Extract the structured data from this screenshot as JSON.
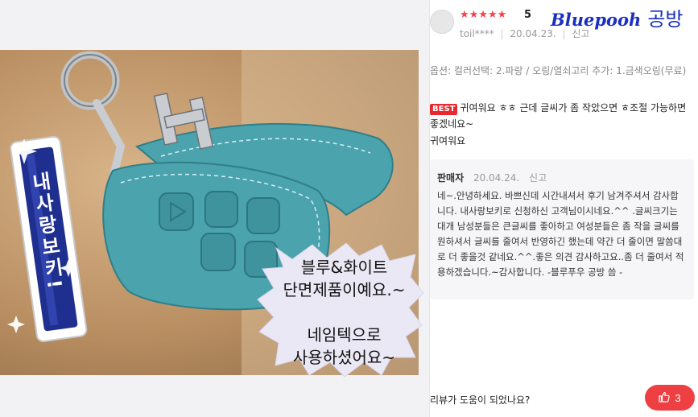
{
  "review": {
    "stars": "★★★★★",
    "rating": "5",
    "user": "toil****",
    "date": "20.04.23.",
    "report": "신고",
    "brand_en": "Bluepooh",
    "brand_kr": "공방",
    "option": "옵션: 컬러선택: 2.파랑 / 오링/열쇠고리 추가: 1.금색오링(무료)",
    "best_badge": "BEST",
    "text": "귀여워요 ㅎㅎ 근데 글씨가 좀 작았으면 ㅎ조절 가능하면 좋겠네요~",
    "text2": "귀여워요"
  },
  "photo": {
    "tag_text": "내사랑보키!",
    "bubble_line1": "블루&화이트",
    "bubble_line2": "단면제품이예요.~",
    "bubble_line3": "네임텍으로",
    "bubble_line4": "사용하셨어요~"
  },
  "reply": {
    "author": "판매자",
    "date": "20.04.24.",
    "report": "신고",
    "body": "네~.안녕하세요. 바쁘신데 시간내셔서 후기 남겨주셔서 감사합니다. 내사랑보키로 신청하신 고객님이시네요.^^ .글씨크기는 대개 남성분들은 큰글씨를 좋아하고 여성분들은 좀 작을 글씨를 원하셔서 글씨를 줄여서 반영하긴 했는데 약간 더 줄이면 말씀대로 더 좋을것 같네요.^^.좋은 의견 감사하고요..좀 더 줄여서 적용하겠습니다.~감사합니다. -블루푸우 공방 씀 -"
  },
  "footer": {
    "helpful_question": "리뷰가 도움이 되었나요?",
    "like_count": "3"
  },
  "colors": {
    "accent_red": "#ee3f42",
    "brand_blue": "#1a2fc0",
    "leather_teal": "#4aa3ad"
  }
}
